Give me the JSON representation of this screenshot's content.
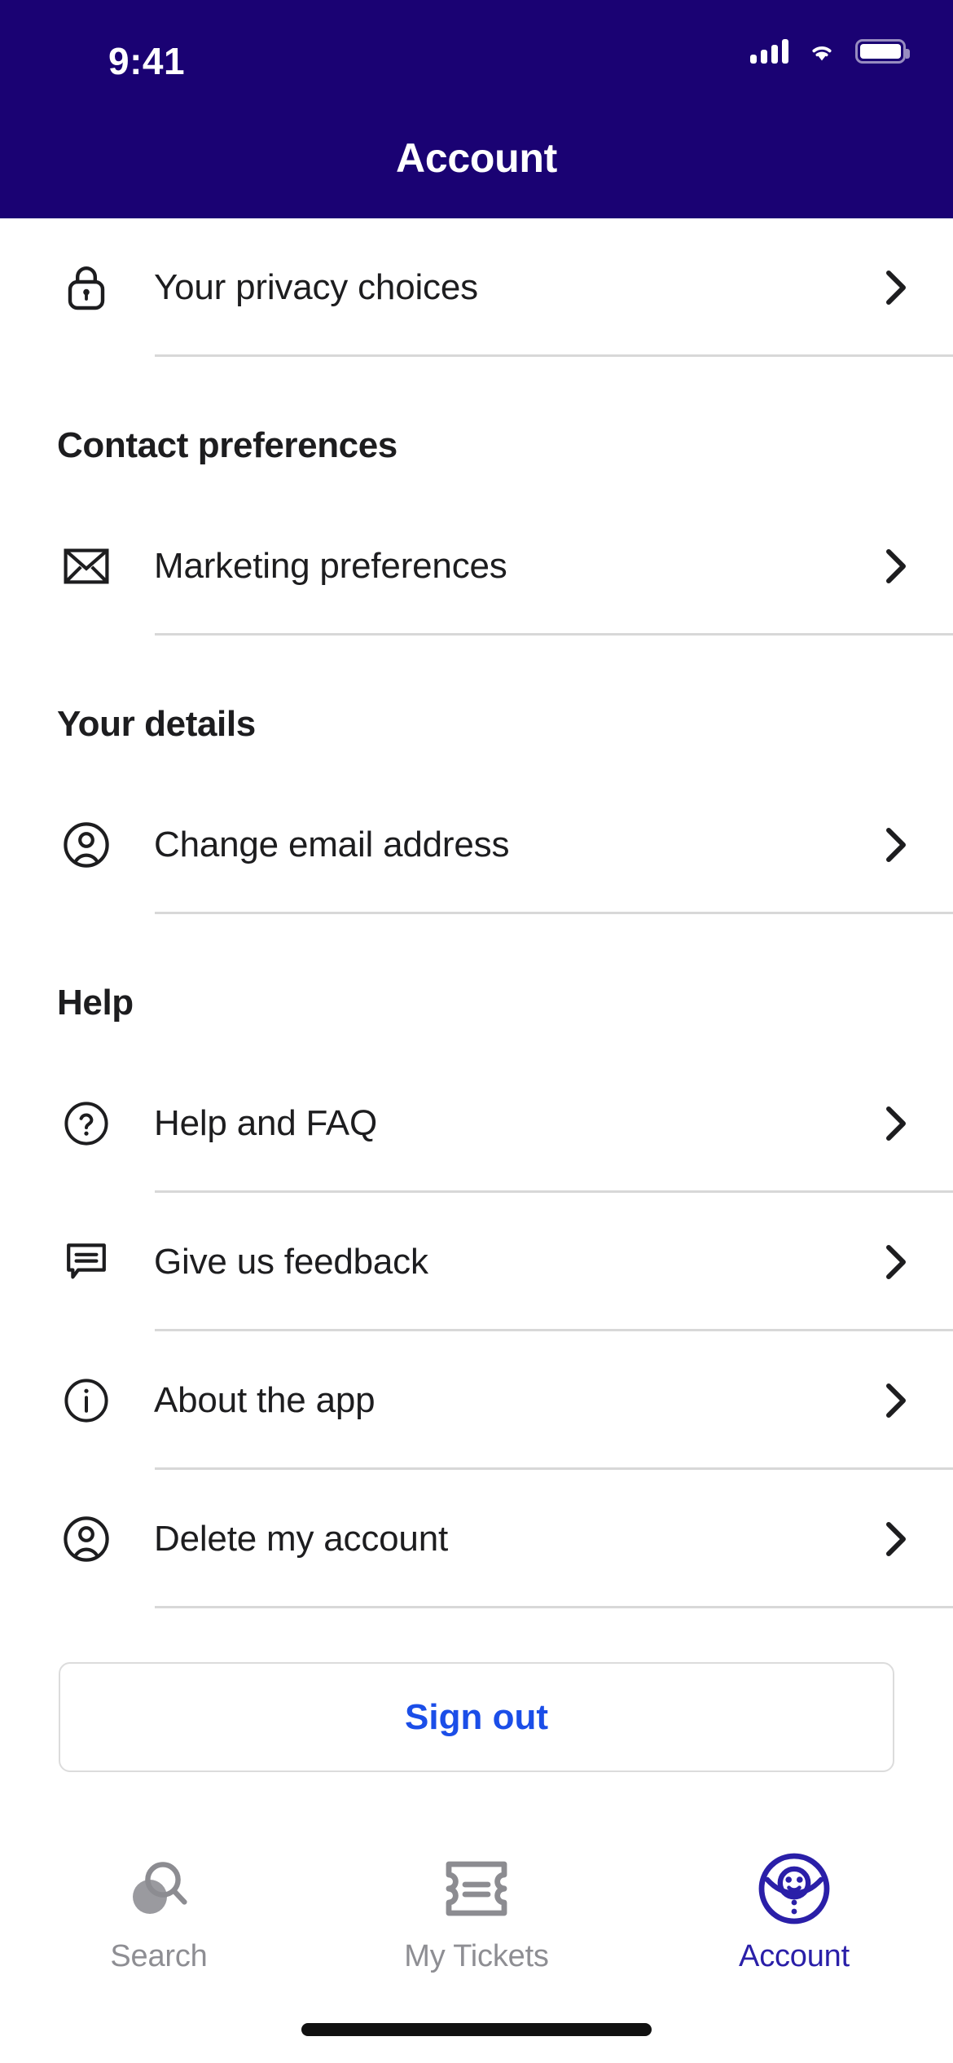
{
  "status_bar": {
    "time": "9:41",
    "signal_icon": "cellular-signal-icon",
    "wifi_icon": "wifi-icon",
    "battery_icon": "battery-icon"
  },
  "header": {
    "title": "Account",
    "background_color": "#1A0273"
  },
  "sections": [
    {
      "title": "",
      "rows": [
        {
          "label": "Your privacy choices",
          "icon": "lock-icon"
        }
      ]
    },
    {
      "title": "Contact preferences",
      "rows": [
        {
          "label": "Marketing preferences",
          "icon": "envelope-icon"
        }
      ]
    },
    {
      "title": "Your details",
      "rows": [
        {
          "label": "Change email address",
          "icon": "person-circle-icon"
        }
      ]
    },
    {
      "title": "Help",
      "rows": [
        {
          "label": "Help and FAQ",
          "icon": "question-circle-icon"
        },
        {
          "label": "Give us feedback",
          "icon": "speech-bubble-icon"
        },
        {
          "label": "About the app",
          "icon": "info-circle-icon"
        },
        {
          "label": "Delete my account",
          "icon": "person-circle-icon"
        }
      ]
    }
  ],
  "sign_out": {
    "label": "Sign out",
    "text_color": "#1b4ee8",
    "border_color": "#dcdcdc"
  },
  "tab_bar": {
    "active_color": "#2A1FA8",
    "inactive_color": "#8e8e93",
    "tabs": [
      {
        "label": "Search",
        "icon": "search-icon",
        "active": false
      },
      {
        "label": "My Tickets",
        "icon": "ticket-icon",
        "active": false
      },
      {
        "label": "Account",
        "icon": "account-avatar-icon",
        "active": true
      }
    ]
  },
  "chevron_icon": "chevron-right-icon",
  "home_indicator": "home-indicator"
}
